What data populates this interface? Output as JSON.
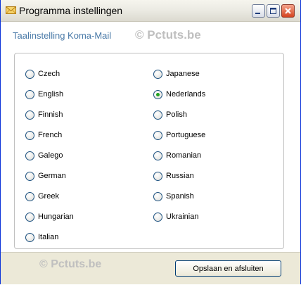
{
  "window": {
    "title": "Programma instellingen"
  },
  "content": {
    "section_label": "Taalinstelling Koma-Mail",
    "watermark_top": "© Pctuts.be",
    "watermark_bottom": "© Pctuts.be"
  },
  "languages": {
    "left": [
      "Czech",
      "English",
      "Finnish",
      "French",
      "Galego",
      "German",
      "Greek",
      "Hungarian",
      "Italian"
    ],
    "right": [
      "Japanese",
      "Nederlands",
      "Polish",
      "Portuguese",
      "Romanian",
      "Russian",
      "Spanish",
      "Ukrainian"
    ],
    "selected": "Nederlands"
  },
  "footer": {
    "save_label": "Opslaan en afsluiten"
  },
  "colors": {
    "label_blue": "#4a7aa8",
    "radio_selected": "#21a121",
    "window_bg": "#ece9d8"
  }
}
